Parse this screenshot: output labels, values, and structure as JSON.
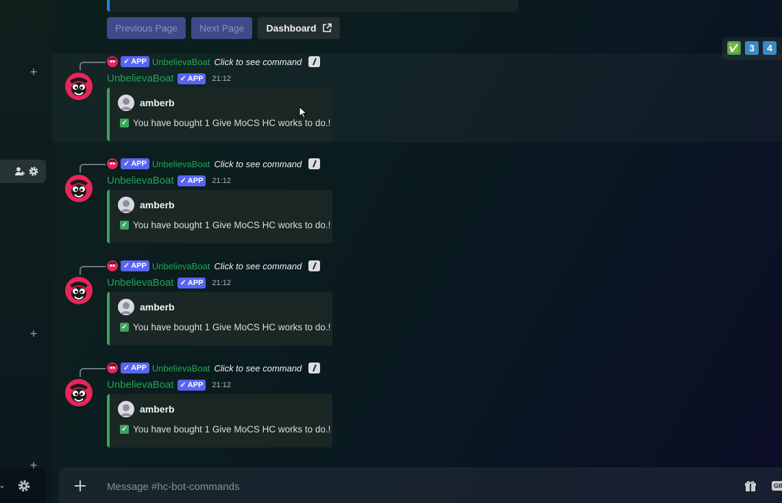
{
  "top_buttons": {
    "previous_page": "Previous Page",
    "next_page": "Next Page",
    "dashboard": "Dashboard"
  },
  "reactions": [
    "✅",
    "3",
    "4"
  ],
  "messages": [
    {
      "reply_username": "UnbelievaBoat",
      "reply_tag": "APP",
      "reply_command_text": "Click to see command",
      "author": "UnbelievaBoat",
      "tag": "APP",
      "timestamp": "21:12",
      "embed_author": "amberb",
      "embed_text": "You have bought 1 Give MoCS HC works to do.!"
    },
    {
      "reply_username": "UnbelievaBoat",
      "reply_tag": "APP",
      "reply_command_text": "Click to see command",
      "author": "UnbelievaBoat",
      "tag": "APP",
      "timestamp": "21:12",
      "embed_author": "amberb",
      "embed_text": "You have bought 1 Give MoCS HC works to do.!"
    },
    {
      "reply_username": "UnbelievaBoat",
      "reply_tag": "APP",
      "reply_command_text": "Click to see command",
      "author": "UnbelievaBoat",
      "tag": "APP",
      "timestamp": "21:12",
      "embed_author": "amberb",
      "embed_text": "You have bought 1 Give MoCS HC works to do.!"
    },
    {
      "reply_username": "UnbelievaBoat",
      "reply_tag": "APP",
      "reply_command_text": "Click to see command",
      "author": "UnbelievaBoat",
      "tag": "APP",
      "timestamp": "21:12",
      "embed_author": "amberb",
      "embed_text": "You have bought 1 Give MoCS HC works to do.!"
    }
  ],
  "composer": {
    "placeholder": "Message #hc-bot-commands",
    "gif_label": "GIF"
  },
  "colors": {
    "bot_name": "#23a559",
    "app_tag": "#5865f2",
    "embed_border": "#3ba55d",
    "link_bar": "#1e88e5"
  },
  "icons": [
    "add-server-icon",
    "add-member-icon",
    "gear-icon",
    "external-link-icon",
    "check-icon",
    "slash-command-icon",
    "plus-circle-icon",
    "gift-icon",
    "gif-icon",
    "chevron-down-icon"
  ]
}
